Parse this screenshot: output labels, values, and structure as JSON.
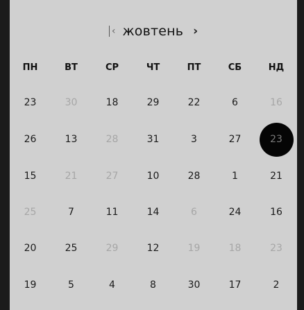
{
  "calendar": {
    "month": "жовтень",
    "prev_icon": "chevron-left-with-bar-icon",
    "next_icon": "chevron-right-icon",
    "prev_glyph": "‹",
    "next_glyph": "›",
    "weekdays": [
      "ПН",
      "ВТ",
      "СР",
      "ЧТ",
      "ПТ",
      "СБ",
      "НД"
    ],
    "weeks": [
      [
        {
          "d": "23",
          "m": false
        },
        {
          "d": "30",
          "m": true
        },
        {
          "d": "18",
          "m": false
        },
        {
          "d": "29",
          "m": false
        },
        {
          "d": "22",
          "m": false
        },
        {
          "d": "6",
          "m": false
        },
        {
          "d": "16",
          "m": true
        }
      ],
      [
        {
          "d": "26",
          "m": false
        },
        {
          "d": "13",
          "m": false
        },
        {
          "d": "28",
          "m": true
        },
        {
          "d": "31",
          "m": false
        },
        {
          "d": "3",
          "m": false
        },
        {
          "d": "27",
          "m": false
        },
        {
          "d": "23",
          "m": false,
          "selected": true
        }
      ],
      [
        {
          "d": "15",
          "m": false
        },
        {
          "d": "21",
          "m": true
        },
        {
          "d": "27",
          "m": true
        },
        {
          "d": "10",
          "m": false
        },
        {
          "d": "28",
          "m": false
        },
        {
          "d": "1",
          "m": false
        },
        {
          "d": "21",
          "m": false
        }
      ],
      [
        {
          "d": "25",
          "m": true
        },
        {
          "d": "7",
          "m": false
        },
        {
          "d": "11",
          "m": false
        },
        {
          "d": "14",
          "m": false
        },
        {
          "d": "6",
          "m": true
        },
        {
          "d": "24",
          "m": false
        },
        {
          "d": "16",
          "m": false
        }
      ],
      [
        {
          "d": "20",
          "m": false
        },
        {
          "d": "25",
          "m": false
        },
        {
          "d": "29",
          "m": true
        },
        {
          "d": "12",
          "m": false
        },
        {
          "d": "19",
          "m": true
        },
        {
          "d": "18",
          "m": true
        },
        {
          "d": "23",
          "m": true
        }
      ],
      [
        {
          "d": "19",
          "m": false
        },
        {
          "d": "5",
          "m": false
        },
        {
          "d": "4",
          "m": false
        },
        {
          "d": "8",
          "m": false
        },
        {
          "d": "30",
          "m": false
        },
        {
          "d": "17",
          "m": false
        },
        {
          "d": "2",
          "m": false
        }
      ]
    ]
  }
}
